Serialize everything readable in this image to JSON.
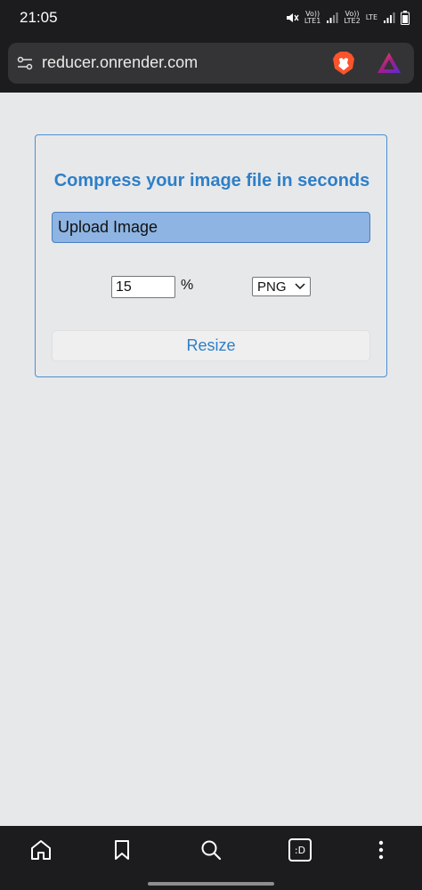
{
  "status_bar": {
    "time": "21:05",
    "sim1_line1": "Vo))",
    "sim1_line2": "LTE1",
    "sim2_line1": "Vo))",
    "sim2_line2": "LTE2",
    "sim2_network": "LTE"
  },
  "browser": {
    "url": "reducer.onrender.com",
    "icons": [
      "tune-icon",
      "brave-lion-icon",
      "brave-rewards-icon"
    ]
  },
  "form": {
    "title": "Compress your image file in seconds",
    "upload_label": "Upload Image",
    "percent_value": "15",
    "percent_sign": "%",
    "format_selected": "PNG",
    "resize_label": "Resize"
  },
  "bottom_nav": {
    "icons": [
      "home-icon",
      "bookmark-icon",
      "search-icon",
      "tabs-icon",
      "more-icon"
    ],
    "tabs_label": ":D"
  },
  "colors": {
    "accent": "#2e7fc7",
    "upload_bg": "#8db4e2",
    "page_bg": "#e7e8ea",
    "chrome_bg": "#1c1c1e"
  }
}
